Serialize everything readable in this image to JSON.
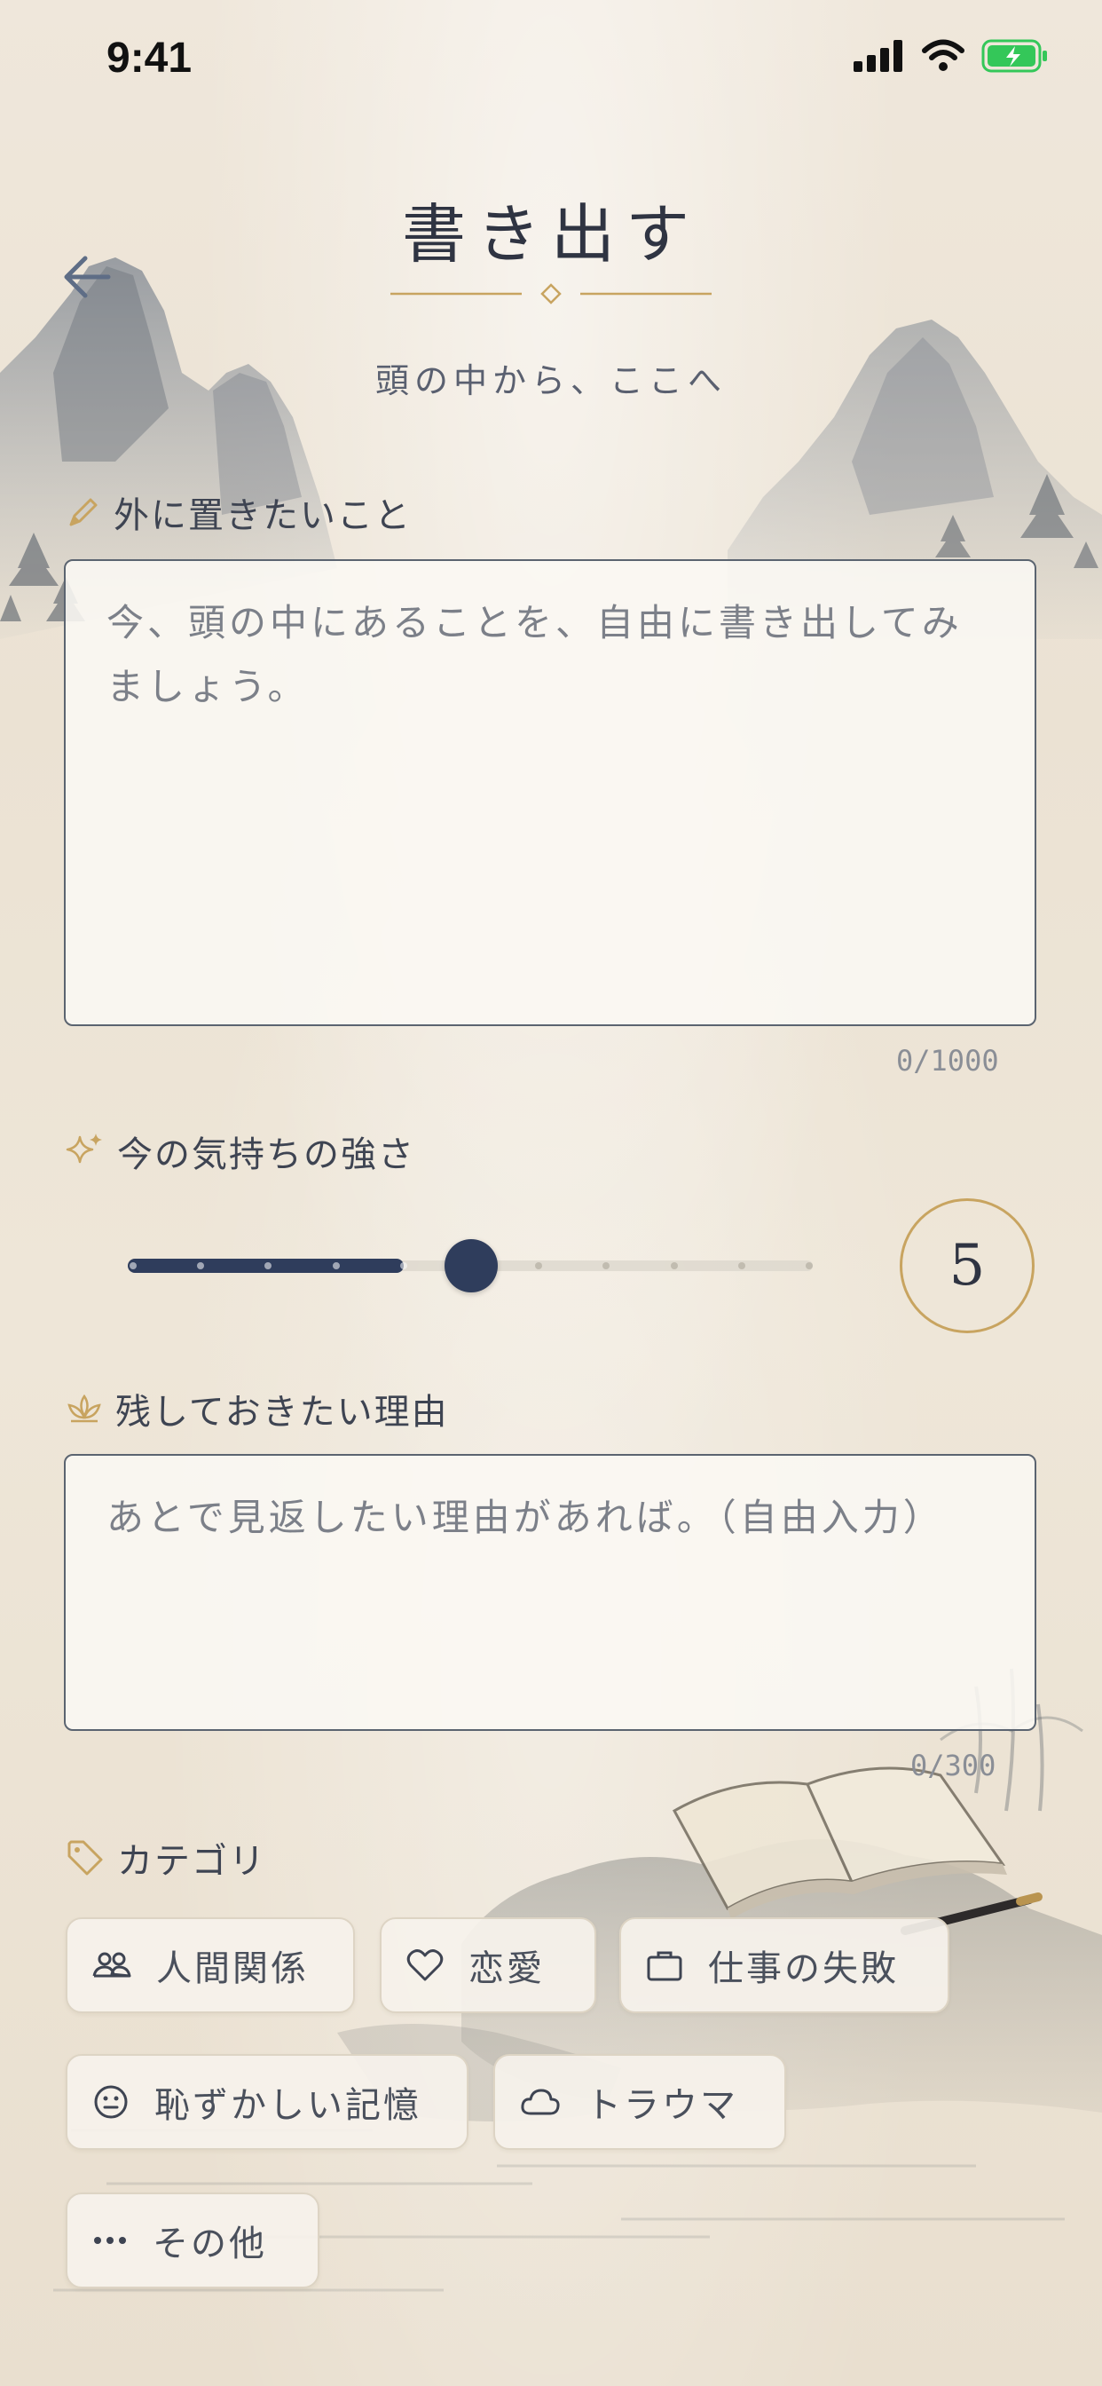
{
  "status": {
    "time": "9:41"
  },
  "header": {
    "title": "書き出す",
    "subtitle": "頭の中から、ここへ"
  },
  "entry": {
    "label": "外に置きたいこと",
    "placeholder": "今、頭の中にあることを、自由に書き出してみましょう。",
    "counter": "0/1000"
  },
  "intensity": {
    "label": "今の気持ちの強さ",
    "value": 5,
    "min": 1,
    "max": 11,
    "display": "5"
  },
  "reason": {
    "label": "残しておきたい理由",
    "placeholder": "あとで見返したい理由があれば。（自由入力）",
    "counter": "0/300"
  },
  "category": {
    "label": "カテゴリ",
    "chips": [
      {
        "label": "人間関係",
        "icon": "people-icon"
      },
      {
        "label": "恋愛",
        "icon": "heart-icon"
      },
      {
        "label": "仕事の失敗",
        "icon": "briefcase-icon"
      },
      {
        "label": "恥ずかしい記憶",
        "icon": "face-icon"
      },
      {
        "label": "トラウマ",
        "icon": "cloud-icon"
      },
      {
        "label": "その他",
        "icon": "more-icon"
      }
    ]
  },
  "colors": {
    "accent_navy": "#2f3d5c",
    "accent_gold": "#c8a460",
    "background": "#ece3d5"
  }
}
